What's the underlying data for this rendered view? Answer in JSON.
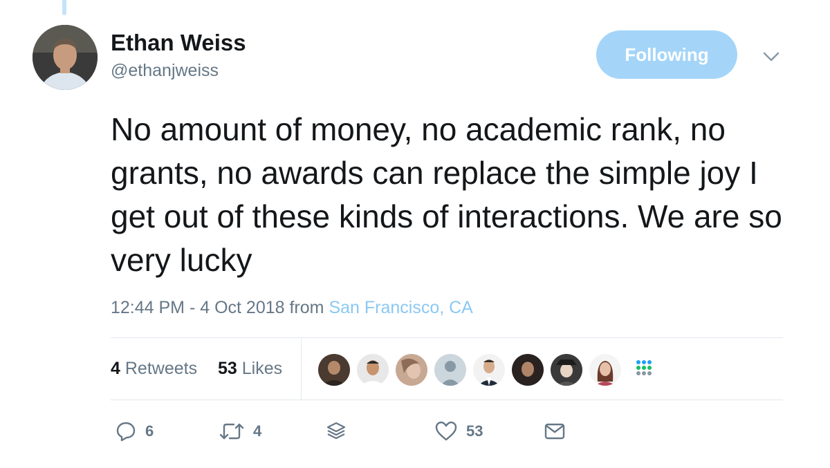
{
  "author": {
    "display_name": "Ethan Weiss",
    "handle": "@ethanjweiss"
  },
  "follow_button": {
    "label": "Following"
  },
  "tweet": {
    "text": "No amount of money, no academic rank, no grants, no awards can replace the simple joy I get out of these kinds of interactions. We are so very lucky",
    "time": "12:44 PM - 4 Oct 2018",
    "from_label": "from",
    "location": "San Francisco, CA"
  },
  "stats": {
    "retweets_count": "4",
    "retweets_label": "Retweets",
    "likes_count": "53",
    "likes_label": "Likes"
  },
  "actions": {
    "reply_count": "6",
    "retweet_count": "4",
    "like_count": "53"
  },
  "icons": {
    "caret": "chevron-down-icon",
    "reply": "reply-icon",
    "retweet": "retweet-icon",
    "stack": "layers-icon",
    "like": "heart-icon",
    "message": "envelope-icon",
    "more_likers": "dots-grid-icon"
  },
  "colors": {
    "follow_button_bg": "#a4d5f8",
    "link": "#8bc8f2",
    "secondary_text": "#657786",
    "primary_text": "#14171a",
    "divider": "#e1e8ed"
  }
}
